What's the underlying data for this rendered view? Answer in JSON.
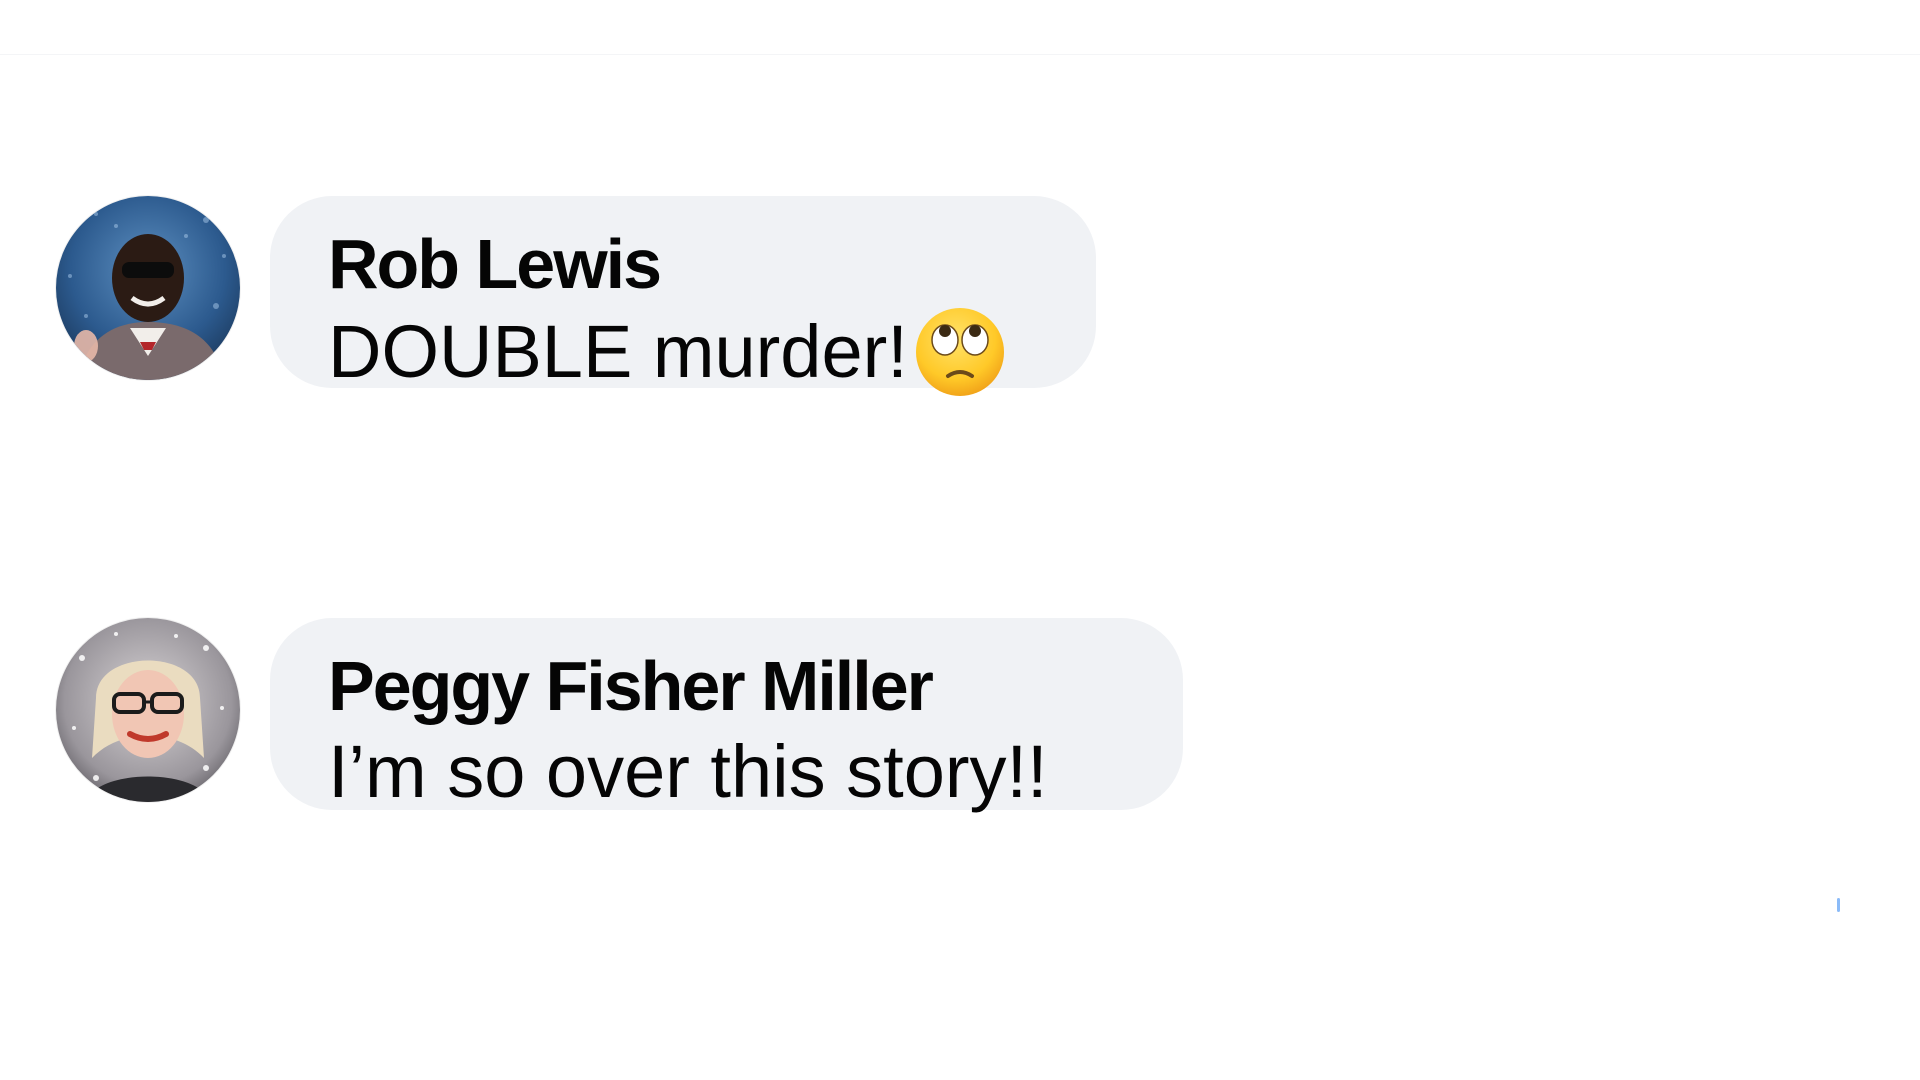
{
  "comments": [
    {
      "author": "Rob Lewis",
      "text": "DOUBLE murder!",
      "emoji": "face-with-rolling-eyes-icon",
      "avatar": "profile-photo-man-sunglasses"
    },
    {
      "author": "Peggy Fisher Miller",
      "text": "I’m so over this story!!",
      "avatar": "profile-photo-woman-glasses"
    }
  ],
  "colors": {
    "bubble": "#f0f2f5",
    "text": "#050505",
    "background": "#ffffff"
  }
}
